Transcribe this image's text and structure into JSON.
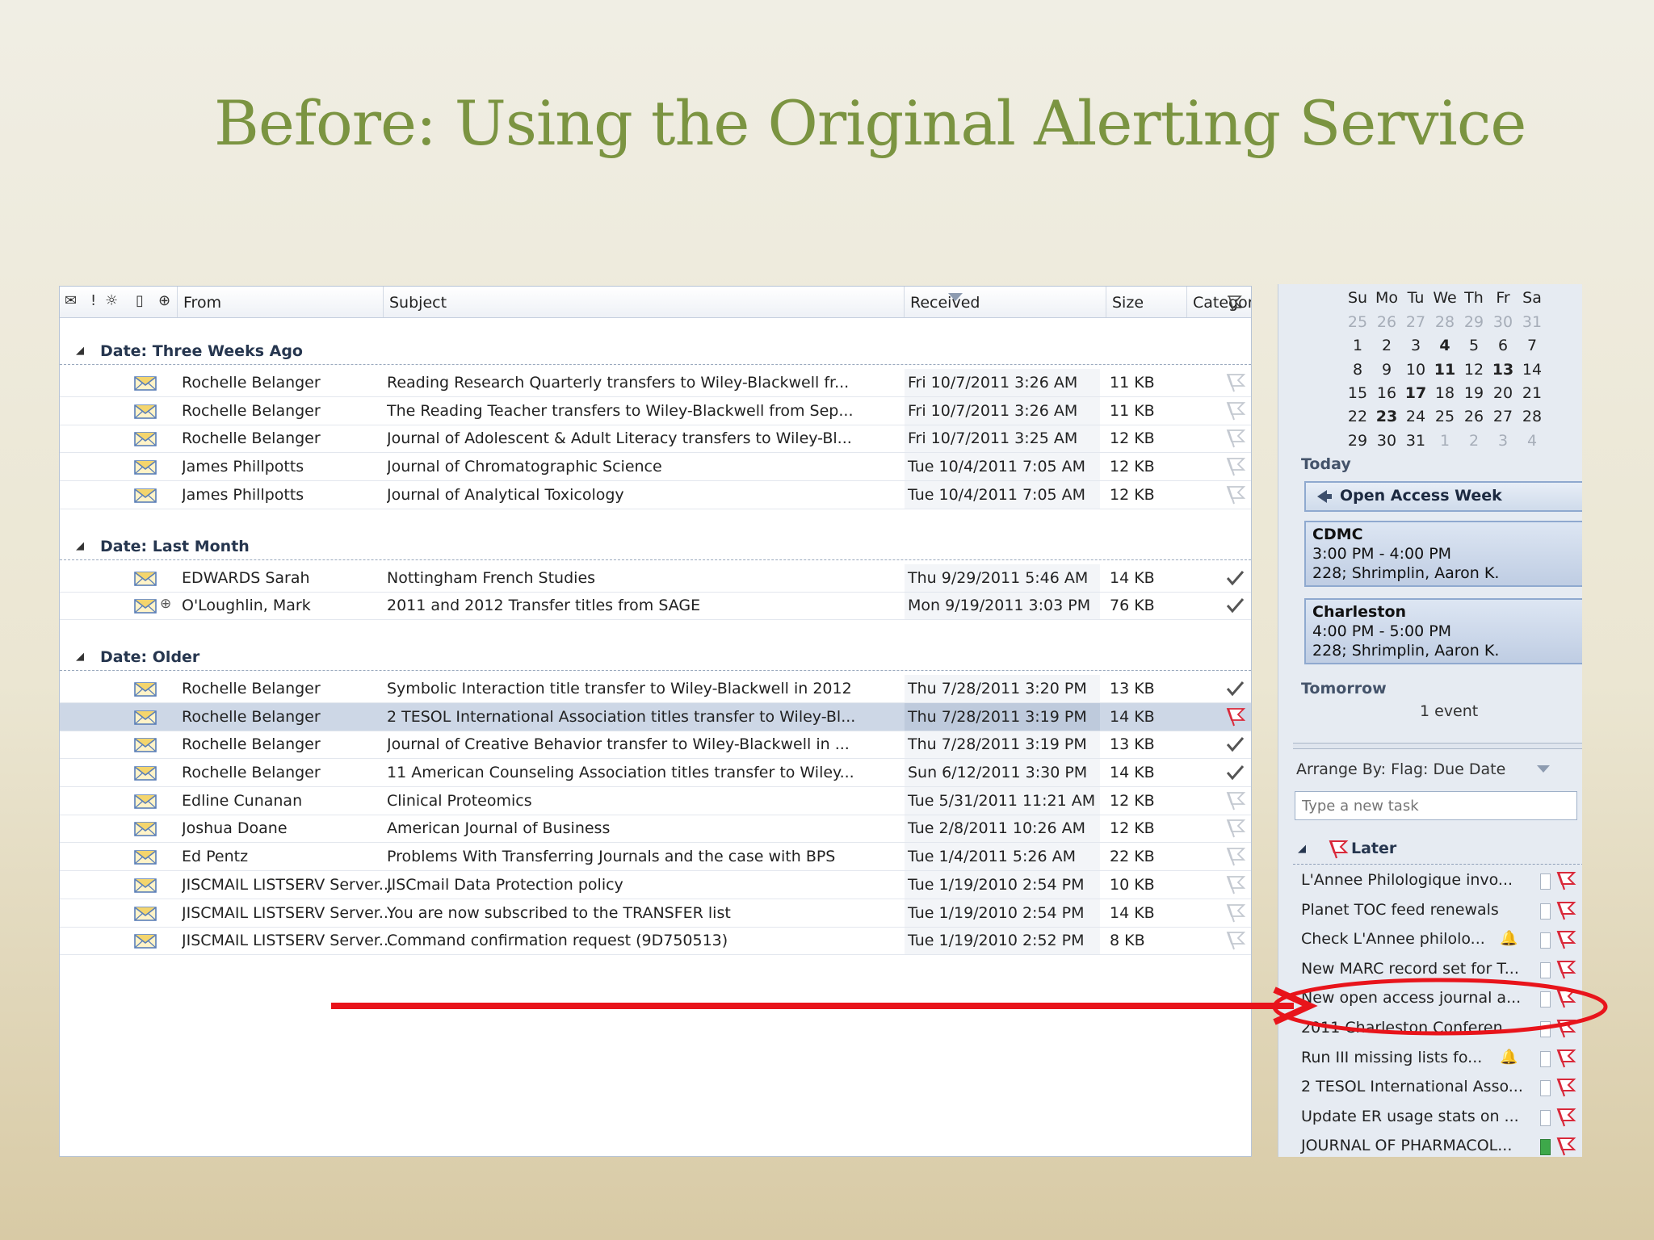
{
  "slide": {
    "title": "Before: Using the Original Alerting Service"
  },
  "mail_list": {
    "columns": {
      "from": "From",
      "subject": "Subject",
      "received": "Received",
      "size": "Size",
      "categories": "Categories"
    },
    "header_icons": [
      "envelope-icon",
      "importance-icon",
      "reminder-icon",
      "document-icon",
      "attachment-icon"
    ],
    "groups": [
      {
        "label": "Date: Three Weeks Ago",
        "rows": [
          {
            "from": "Rochelle Belanger",
            "subject": "Reading Research Quarterly transfers to Wiley-Blackwell fr...",
            "received": "Fri 10/7/2011 3:26 AM",
            "size": "11 KB",
            "flag": "flag-empty",
            "attachment": false
          },
          {
            "from": "Rochelle Belanger",
            "subject": "The Reading Teacher transfers to Wiley-Blackwell from Sep...",
            "received": "Fri 10/7/2011 3:26 AM",
            "size": "11 KB",
            "flag": "flag-empty",
            "attachment": false
          },
          {
            "from": "Rochelle Belanger",
            "subject": "Journal of Adolescent & Adult Literacy transfers to Wiley-Bl...",
            "received": "Fri 10/7/2011 3:25 AM",
            "size": "12 KB",
            "flag": "flag-empty",
            "attachment": false
          },
          {
            "from": "James Phillpotts",
            "subject": "Journal of Chromatographic Science",
            "received": "Tue 10/4/2011 7:05 AM",
            "size": "12 KB",
            "flag": "flag-empty",
            "attachment": false
          },
          {
            "from": "James Phillpotts",
            "subject": "Journal of Analytical Toxicology",
            "received": "Tue 10/4/2011 7:05 AM",
            "size": "12 KB",
            "flag": "flag-empty",
            "attachment": false
          }
        ]
      },
      {
        "label": "Date: Last Month",
        "rows": [
          {
            "from": "EDWARDS Sarah",
            "subject": "Nottingham French Studies",
            "received": "Thu 9/29/2011 5:46 AM",
            "size": "14 KB",
            "flag": "check",
            "attachment": false
          },
          {
            "from": "O'Loughlin, Mark",
            "subject": "2011 and 2012 Transfer titles from SAGE",
            "received": "Mon 9/19/2011 3:03 PM",
            "size": "76 KB",
            "flag": "check",
            "attachment": true
          }
        ]
      },
      {
        "label": "Date: Older",
        "rows": [
          {
            "from": "Rochelle Belanger",
            "subject": "Symbolic Interaction title transfer to Wiley-Blackwell in 2012",
            "received": "Thu 7/28/2011 3:20 PM",
            "size": "13 KB",
            "flag": "check",
            "attachment": false
          },
          {
            "from": "Rochelle Belanger",
            "subject": "2 TESOL International Association titles transfer to Wiley-Bl...",
            "received": "Thu 7/28/2011 3:19 PM",
            "size": "14 KB",
            "flag": "flag-red",
            "attachment": false,
            "selected": true
          },
          {
            "from": "Rochelle Belanger",
            "subject": "Journal of Creative Behavior transfer to Wiley-Blackwell in ...",
            "received": "Thu 7/28/2011 3:19 PM",
            "size": "13 KB",
            "flag": "check",
            "attachment": false
          },
          {
            "from": "Rochelle Belanger",
            "subject": "11 American Counseling Association titles transfer to Wiley...",
            "received": "Sun 6/12/2011 3:30 PM",
            "size": "14 KB",
            "flag": "check",
            "attachment": false
          },
          {
            "from": "Edline Cunanan",
            "subject": "Clinical Proteomics",
            "received": "Tue 5/31/2011 11:21 AM",
            "size": "12 KB",
            "flag": "flag-empty",
            "attachment": false
          },
          {
            "from": "Joshua Doane",
            "subject": "American Journal of Business",
            "received": "Tue 2/8/2011 10:26 AM",
            "size": "12 KB",
            "flag": "flag-empty",
            "attachment": false
          },
          {
            "from": "Ed Pentz",
            "subject": "Problems With Transferring Journals and the case with BPS",
            "received": "Tue 1/4/2011 5:26 AM",
            "size": "22 KB",
            "flag": "flag-empty",
            "attachment": false
          },
          {
            "from": "JISCMAIL LISTSERV Server...",
            "subject": "JISCmail Data Protection policy",
            "received": "Tue 1/19/2010 2:54 PM",
            "size": "10 KB",
            "flag": "flag-empty",
            "attachment": false
          },
          {
            "from": "JISCMAIL LISTSERV Server...",
            "subject": "You are now subscribed to the TRANSFER list",
            "received": "Tue 1/19/2010 2:54 PM",
            "size": "14 KB",
            "flag": "flag-empty",
            "attachment": false
          },
          {
            "from": "JISCMAIL LISTSERV Server...",
            "subject": "Command confirmation request (9D750513)",
            "received": "Tue 1/19/2010 2:52 PM",
            "size": "8 KB",
            "flag": "flag-empty",
            "attachment": false
          }
        ]
      }
    ]
  },
  "calendar": {
    "day_headers": [
      "Su",
      "Mo",
      "Tu",
      "We",
      "Th",
      "Fr",
      "Sa"
    ],
    "weeks": [
      [
        {
          "d": "25",
          "s": "dim"
        },
        {
          "d": "26",
          "s": "dim"
        },
        {
          "d": "27",
          "s": "dim"
        },
        {
          "d": "28",
          "s": "dim"
        },
        {
          "d": "29",
          "s": "dim"
        },
        {
          "d": "30",
          "s": "dim"
        },
        {
          "d": "31",
          "s": "dim"
        }
      ],
      [
        {
          "d": "1"
        },
        {
          "d": "2"
        },
        {
          "d": "3"
        },
        {
          "d": "4",
          "s": "bold"
        },
        {
          "d": "5"
        },
        {
          "d": "6"
        },
        {
          "d": "7"
        }
      ],
      [
        {
          "d": "8"
        },
        {
          "d": "9"
        },
        {
          "d": "10"
        },
        {
          "d": "11",
          "s": "bold"
        },
        {
          "d": "12"
        },
        {
          "d": "13",
          "s": "bold"
        },
        {
          "d": "14"
        }
      ],
      [
        {
          "d": "15"
        },
        {
          "d": "16"
        },
        {
          "d": "17",
          "s": "bold"
        },
        {
          "d": "18"
        },
        {
          "d": "19"
        },
        {
          "d": "20"
        },
        {
          "d": "21"
        }
      ],
      [
        {
          "d": "22"
        },
        {
          "d": "23",
          "s": "bold"
        },
        {
          "d": "24"
        },
        {
          "d": "25"
        },
        {
          "d": "26"
        },
        {
          "d": "27"
        },
        {
          "d": "28"
        }
      ],
      [
        {
          "d": "29"
        },
        {
          "d": "30"
        },
        {
          "d": "31"
        },
        {
          "d": "1",
          "s": "dim"
        },
        {
          "d": "2",
          "s": "dim"
        },
        {
          "d": "3",
          "s": "dim"
        },
        {
          "d": "4",
          "s": "dim"
        }
      ]
    ]
  },
  "agenda": {
    "today_label": "Today",
    "all_day_event": "Open Access Week",
    "appointments": [
      {
        "title": "CDMC",
        "time": "3:00 PM - 4:00 PM",
        "location": "228; Shrimplin, Aaron K."
      },
      {
        "title": "Charleston",
        "time": "4:00 PM - 5:00 PM",
        "location": "228; Shrimplin, Aaron K."
      }
    ],
    "tomorrow_label": "Tomorrow",
    "tomorrow_count": "1 event"
  },
  "tasks": {
    "arrange_by": "Arrange By: Flag: Due Date",
    "new_task_placeholder": "Type a new task",
    "group_label": "Later",
    "items": [
      {
        "title": "L'Annee Philologique invo...",
        "bell": false,
        "category": "none"
      },
      {
        "title": "Planet TOC feed renewals",
        "bell": false,
        "category": "none"
      },
      {
        "title": "Check L'Annee philolo...",
        "bell": true,
        "category": "none"
      },
      {
        "title": "New MARC record set for T...",
        "bell": false,
        "category": "none"
      },
      {
        "title": "New open access journal a...",
        "bell": false,
        "category": "none"
      },
      {
        "title": "2011 Charleston Conferen...",
        "bell": false,
        "category": "none"
      },
      {
        "title": "Run III missing lists fo...",
        "bell": true,
        "category": "none"
      },
      {
        "title": "2 TESOL International Asso...",
        "bell": false,
        "category": "none"
      },
      {
        "title": "Update ER usage stats on ...",
        "bell": false,
        "category": "none"
      },
      {
        "title": "JOURNAL OF PHARMACOL...",
        "bell": false,
        "category": "green"
      }
    ]
  },
  "colors": {
    "title": "#7b9441",
    "annotation": "#e8141b",
    "flag": "#d9293a",
    "selection": "#cdd7e6"
  }
}
